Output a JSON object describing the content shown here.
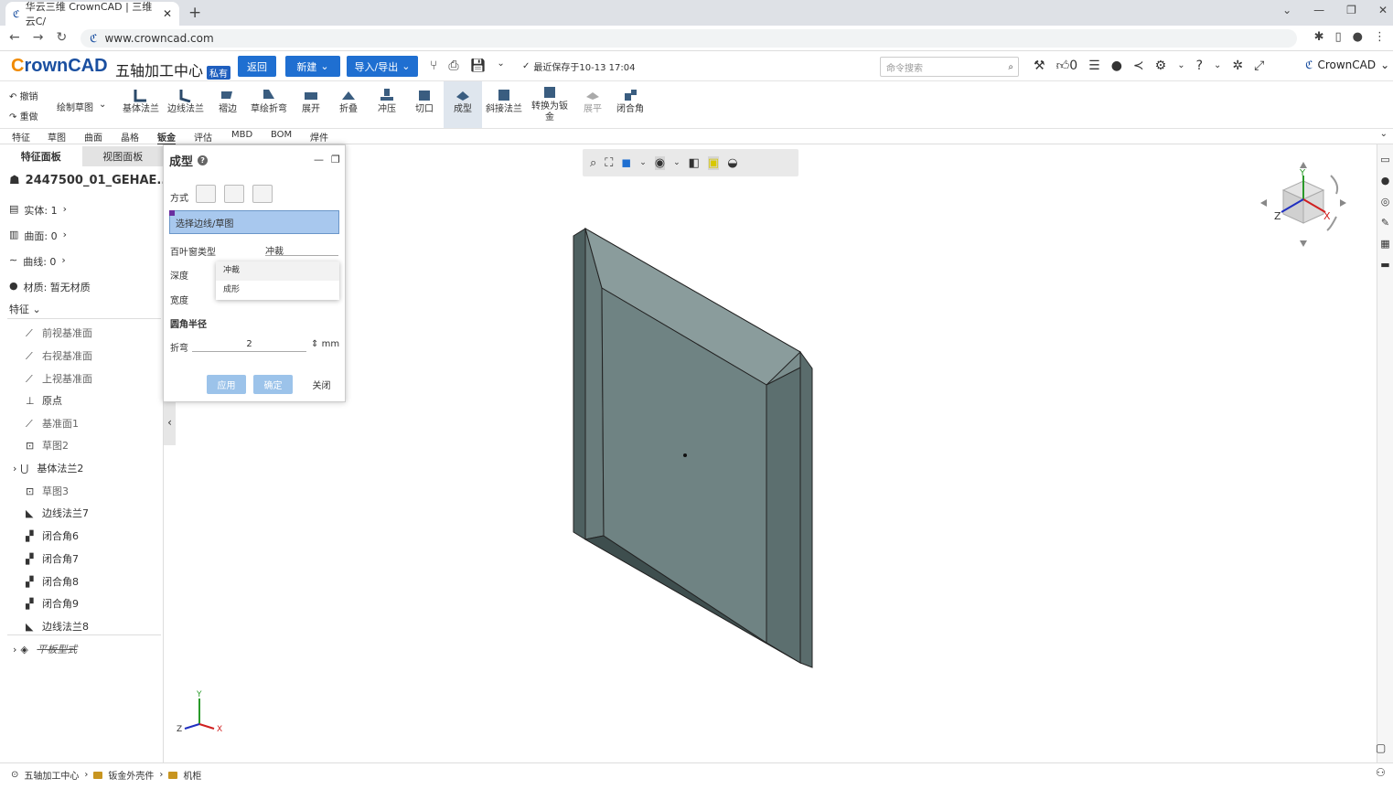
{
  "browser": {
    "tab_title": "华云三维 CrownCAD | 三维云C/",
    "url": "www.crowncad.com"
  },
  "header": {
    "logo_text": "rownCAD",
    "logo_c": "C",
    "project": "五轴加工中心",
    "badge": "私有",
    "back_label": "返回",
    "new_label": "新建",
    "io_label": "导入/导出",
    "saved_text": "最近保存于10-13 17:04",
    "search_placeholder": "命令搜索",
    "like_count": "0",
    "user": "CrownCAD"
  },
  "ribbon": {
    "undo": "撤销",
    "redo": "重做",
    "sketch": "绘制草图",
    "tools": [
      "基体法兰",
      "边线法兰",
      "褶边",
      "草绘折弯",
      "展开",
      "折叠",
      "冲压",
      "切口",
      "成型",
      "斜接法兰",
      "转换为钣金",
      "展平",
      "闭合角"
    ]
  },
  "menu_tabs": [
    "特征",
    "草图",
    "曲面",
    "晶格",
    "钣金",
    "评估",
    "MBD",
    "BOM",
    "焊件"
  ],
  "left_panel": {
    "tab_feature": "特征面板",
    "tab_view": "视图面板",
    "part_name": "2447500_01_GEHAE...",
    "solids": "实体: 1",
    "surfaces": "曲面: 0",
    "curves": "曲线: 0",
    "material": "材质: 暂无材质",
    "features_label": "特征",
    "tree": [
      "前视基准面",
      "右视基准面",
      "上视基准面",
      "原点",
      "基准面1",
      "草图2",
      "基体法兰2",
      "草图3",
      "边线法兰7",
      "闭合角6",
      "闭合角7",
      "闭合角8",
      "闭合角9",
      "边线法兰8",
      "平板型式"
    ]
  },
  "dialog": {
    "title": "成型",
    "mode_label": "方式",
    "select_label": "选择边线/草图",
    "louver_label": "百叶窗类型",
    "louver_value": "冲裁",
    "depth_label": "深度",
    "width_label": "宽度",
    "options": [
      "冲裁",
      "成形"
    ],
    "fillet_label": "圆角半径",
    "bend_label": "折弯",
    "bend_value": "2",
    "bend_unit": "mm",
    "apply": "应用",
    "ok": "确定",
    "close": "关闭"
  },
  "axes": {
    "x": "X",
    "y": "Y",
    "z": "Z"
  },
  "breadcrumb": [
    "五轴加工中心",
    "钣金外壳件",
    "机柜"
  ],
  "colors": {
    "accent": "#1f6fd1",
    "part": "#6f8383"
  }
}
